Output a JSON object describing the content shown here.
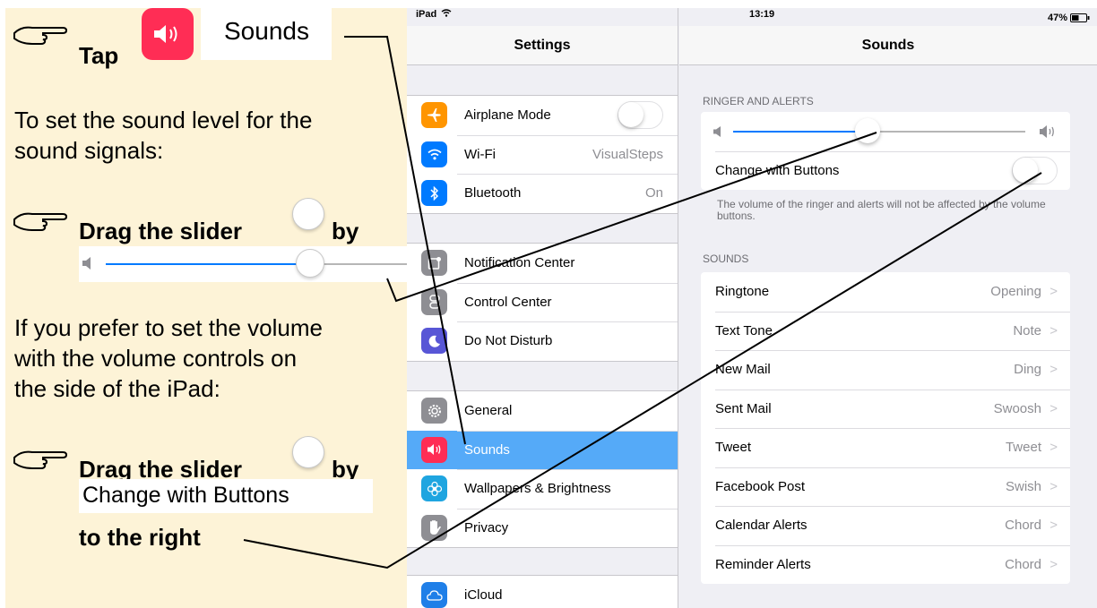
{
  "guide": {
    "step1_tap": "Tap",
    "step1_chip": "Sounds",
    "para1_line1": "To set the sound level for the",
    "para1_line2": "sound signals:",
    "step2": "Drag the slider",
    "step2_by": "by",
    "para2_line1": "If you prefer to set the volume",
    "para2_line2": "with the volume controls on",
    "para2_line3": "the side of the iPad:",
    "step3": "Drag the slider",
    "step3_by": "by",
    "step3_chip": "Change with Buttons",
    "step3_end": "to the right",
    "mini_slider_level": 0.68
  },
  "status": {
    "device": "iPad",
    "time": "13:19",
    "battery": "47%"
  },
  "master": {
    "title": "Settings",
    "group1": [
      {
        "label": "Airplane Mode",
        "icon": "airplane-icon",
        "color": "#ff9500",
        "control": "switch"
      },
      {
        "label": "Wi-Fi",
        "icon": "wifi-icon",
        "color": "#007aff",
        "value": "VisualSteps"
      },
      {
        "label": "Bluetooth",
        "icon": "bluetooth-icon",
        "color": "#007aff",
        "value": "On"
      }
    ],
    "group2": [
      {
        "label": "Notification Center",
        "icon": "notification-center-icon",
        "color": "#8e8e93"
      },
      {
        "label": "Control Center",
        "icon": "control-center-icon",
        "color": "#8e8e93"
      },
      {
        "label": "Do Not Disturb",
        "icon": "moon-icon",
        "color": "#5856d6"
      }
    ],
    "group3": [
      {
        "label": "General",
        "icon": "gear-icon",
        "color": "#8e8e93"
      },
      {
        "label": "Sounds",
        "icon": "speaker-icon",
        "color": "#ff2d55",
        "selected": true
      },
      {
        "label": "Wallpapers & Brightness",
        "icon": "flower-icon",
        "color": "#1fa5e0"
      },
      {
        "label": "Privacy",
        "icon": "hand-icon",
        "color": "#8e8e93"
      }
    ],
    "group4": [
      {
        "label": "iCloud",
        "icon": "cloud-icon",
        "color": "#1f7fe8"
      }
    ]
  },
  "detail": {
    "title": "Sounds",
    "ringer_header": "RINGER AND ALERTS",
    "ringer_level": 0.46,
    "change_with_buttons": "Change with Buttons",
    "change_with_buttons_on": false,
    "footnote": "The volume of the ringer and alerts will not be affected by the volume buttons.",
    "sounds_header": "SOUNDS",
    "sounds": [
      {
        "label": "Ringtone",
        "value": "Opening"
      },
      {
        "label": "Text Tone",
        "value": "Note"
      },
      {
        "label": "New Mail",
        "value": "Ding"
      },
      {
        "label": "Sent Mail",
        "value": "Swoosh"
      },
      {
        "label": "Tweet",
        "value": "Tweet"
      },
      {
        "label": "Facebook Post",
        "value": "Swish"
      },
      {
        "label": "Calendar Alerts",
        "value": "Chord"
      },
      {
        "label": "Reminder Alerts",
        "value": "Chord"
      }
    ],
    "chevron": ">"
  },
  "colors": {
    "accent": "#007aff",
    "selected_row": "#55aaf8",
    "guide_bg": "#fdf3d7",
    "sounds_icon": "#ff2d55"
  }
}
